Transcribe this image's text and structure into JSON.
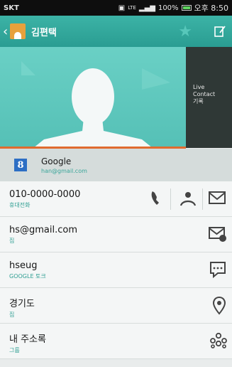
{
  "status_bar": {
    "carrier": "SKT",
    "network": "LTE",
    "battery": "100%",
    "time": "오후 8:50"
  },
  "action_bar": {
    "title": "김편택"
  },
  "live_panel": {
    "line1": "Live",
    "line2": "Contact",
    "line3": "기록"
  },
  "account": {
    "name": "Google",
    "email": "han@gmail.com",
    "logo": "8"
  },
  "rows": [
    {
      "value": "010-0000-0000",
      "type": "휴대전화"
    },
    {
      "value": "hs@gmail.com",
      "type": "집"
    },
    {
      "value": "hseug",
      "type": "GOOGLE 토크"
    },
    {
      "value": "경기도",
      "type": "집"
    },
    {
      "value": "내 주소록",
      "type": "그룹"
    }
  ],
  "colors": {
    "accent": "#2a9d92",
    "hero": "#54c2b8",
    "highlight_line": "#e06b2f"
  }
}
